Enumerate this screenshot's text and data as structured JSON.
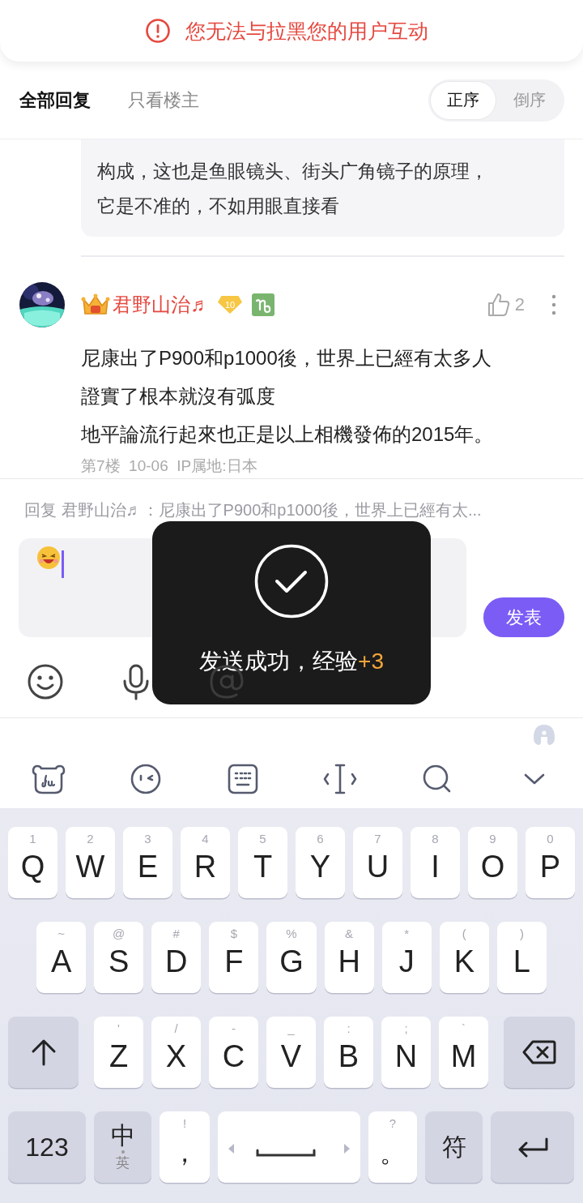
{
  "alert": {
    "text": "您无法与拉黑您的用户互动"
  },
  "tabs": [
    {
      "label": "全部回复",
      "selected": true
    },
    {
      "label": "只看楼主",
      "selected": false
    }
  ],
  "sort": [
    {
      "label": "正序",
      "selected": true
    },
    {
      "label": "倒序",
      "selected": false
    }
  ],
  "quote": {
    "lines": [
      "构成，这也是鱼眼镜头、街头广角镜子的原理，",
      "它是不准的，不如用眼直接看"
    ]
  },
  "comment": {
    "avatar": {
      "kind": "picture"
    },
    "author": "君野山治♬",
    "level": "10",
    "likes": "2",
    "lines": [
      "尼康出了P900和p1000後，世界上已經有太多人",
      "證實了根本就沒有弧度",
      "地平論流行起來也正是以上相機發佈的2015年。"
    ],
    "meta": "第7楼  10-06  IP属地:日本"
  },
  "reply": {
    "target": "回复 君野山治♬：尼康出了P900和p1000後，世界上已經有太...",
    "send": "发表",
    "tools": [
      {
        "kind": "emoji"
      },
      {
        "kind": "voice"
      },
      {
        "kind": "mention"
      }
    ]
  },
  "toast": {
    "text": "发送成功，经验",
    "bonus": "+3"
  },
  "keyboard": {
    "toolbar": [
      {
        "kind": "du"
      },
      {
        "kind": "face"
      },
      {
        "kind": "keyboard"
      },
      {
        "kind": "cursor"
      },
      {
        "kind": "search"
      },
      {
        "kind": "hide"
      }
    ],
    "rows": [
      [
        {
          "kind": "letter",
          "label": "Q",
          "hint": "1"
        },
        {
          "kind": "letter",
          "label": "W",
          "hint": "2"
        },
        {
          "kind": "letter",
          "label": "E",
          "hint": "3"
        },
        {
          "kind": "letter",
          "label": "R",
          "hint": "4"
        },
        {
          "kind": "letter",
          "label": "T",
          "hint": "5"
        },
        {
          "kind": "letter",
          "label": "Y",
          "hint": "6"
        },
        {
          "kind": "letter",
          "label": "U",
          "hint": "7"
        },
        {
          "kind": "letter",
          "label": "I",
          "hint": "8"
        },
        {
          "kind": "letter",
          "label": "O",
          "hint": "9"
        },
        {
          "kind": "letter",
          "label": "P",
          "hint": "0"
        }
      ],
      [
        {
          "kind": "letter",
          "label": "A",
          "hint": "~"
        },
        {
          "kind": "letter",
          "label": "S",
          "hint": "@"
        },
        {
          "kind": "letter",
          "label": "D",
          "hint": "#"
        },
        {
          "kind": "letter",
          "label": "F",
          "hint": "$"
        },
        {
          "kind": "letter",
          "label": "G",
          "hint": "%"
        },
        {
          "kind": "letter",
          "label": "H",
          "hint": "&"
        },
        {
          "kind": "letter",
          "label": "J",
          "hint": "*"
        },
        {
          "kind": "letter",
          "label": "K",
          "hint": "("
        },
        {
          "kind": "letter",
          "label": "L",
          "hint": ")"
        }
      ],
      [
        {
          "kind": "shift"
        },
        {
          "kind": "letter",
          "label": "Z",
          "hint": "'"
        },
        {
          "kind": "letter",
          "label": "X",
          "hint": "/"
        },
        {
          "kind": "letter",
          "label": "C",
          "hint": "-"
        },
        {
          "kind": "letter",
          "label": "V",
          "hint": "_"
        },
        {
          "kind": "letter",
          "label": "B",
          "hint": ":"
        },
        {
          "kind": "letter",
          "label": "N",
          "hint": ";"
        },
        {
          "kind": "letter",
          "label": "M",
          "hint": "`"
        },
        {
          "kind": "backspace"
        }
      ],
      [
        {
          "kind": "numbers",
          "label": "123"
        },
        {
          "kind": "lang",
          "label": "中",
          "sub": "英"
        },
        {
          "kind": "punct",
          "label": "，",
          "hint": "!"
        },
        {
          "kind": "space"
        },
        {
          "kind": "punct",
          "label": "。",
          "hint": "?"
        },
        {
          "kind": "symbols",
          "label": "符"
        },
        {
          "kind": "enter"
        }
      ]
    ]
  }
}
